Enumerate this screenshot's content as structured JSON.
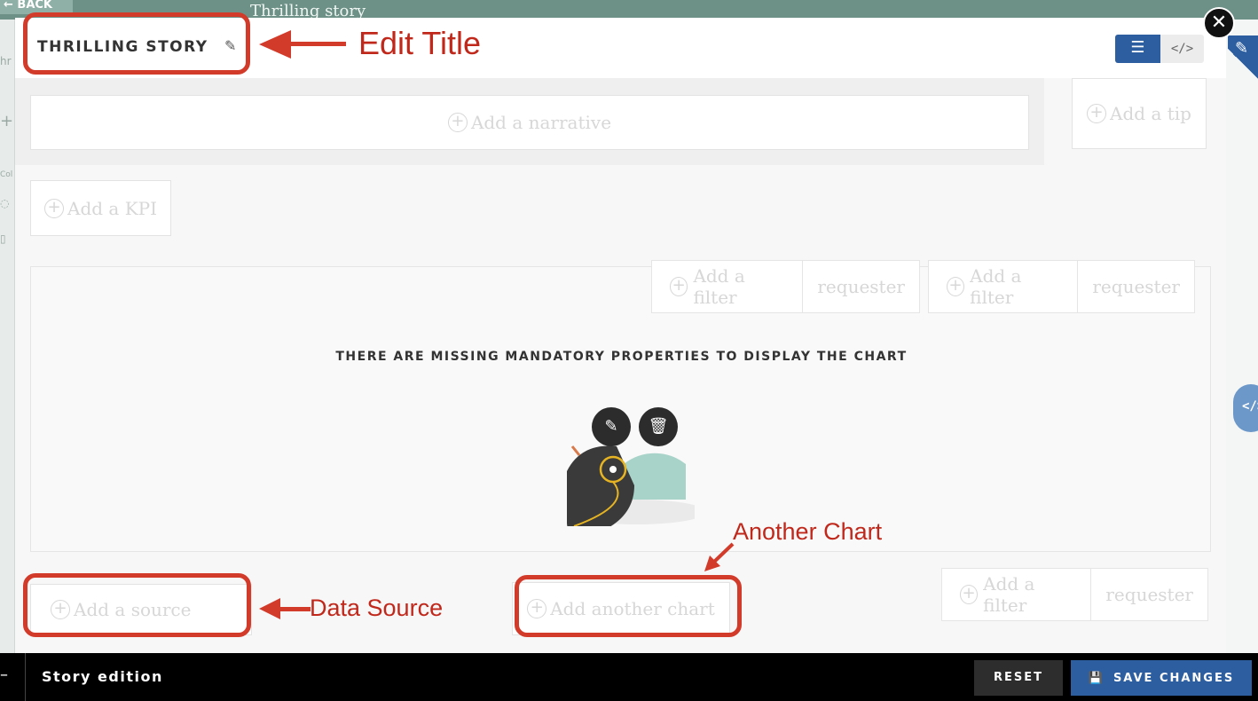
{
  "background": {
    "back_label": "← BACK",
    "story_title": "Thrilling story"
  },
  "modal": {
    "title": "THRILLING STORY",
    "view_toggle": {
      "layout_icon": "layout-rows-icon",
      "code_icon": "code-icon"
    },
    "narrative_placeholder": "Add a narrative",
    "tip_placeholder": "Add a tip",
    "kpi_placeholder": "Add a KPI",
    "chart": {
      "filters": [
        {
          "add_label": "Add a filter",
          "requester_label": "requester"
        },
        {
          "add_label": "Add a filter",
          "requester_label": "requester"
        }
      ],
      "missing_message": "THERE ARE MISSING MANDATORY PROPERTIES TO DISPLAY THE CHART"
    },
    "footer": {
      "source_placeholder": "Add a source",
      "another_chart_placeholder": "Add another chart",
      "filter": {
        "add_label": "Add a filter",
        "requester_label": "requester"
      }
    }
  },
  "annotations": {
    "edit_title": "Edit Title",
    "another_chart": "Another Chart",
    "data_source": "Data Source"
  },
  "bottom_bar": {
    "title": "Story edition",
    "reset_label": "RESET",
    "save_label": "SAVE CHANGES"
  },
  "colors": {
    "accent": "#2d5fa0",
    "annotation": "#d23a2a",
    "bird_teal": "#a8d3c8",
    "bird_dark": "#3a3a3a",
    "bird_gold": "#e6b422"
  }
}
